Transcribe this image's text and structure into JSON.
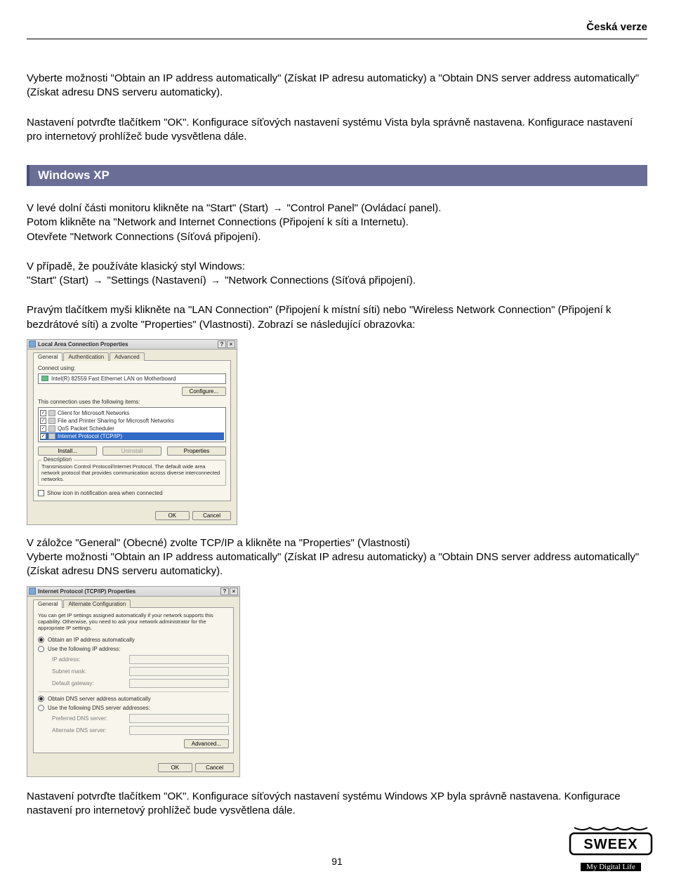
{
  "header": {
    "label": "Česká verze"
  },
  "intro": {
    "p1": "Vyberte možnosti \"Obtain an IP address automatically\" (Získat IP adresu automaticky) a \"Obtain DNS server address automatically\" (Získat adresu DNS serveru automaticky).",
    "p2": "Nastavení potvrďte tlačítkem \"OK\". Konfigurace síťových nastavení systému Vista byla správně nastavena. Konfigurace nastavení pro internetový prohlížeč bude vysvětlena dále."
  },
  "section": {
    "title": "Windows XP"
  },
  "xp": {
    "p1a": "V levé dolní části monitoru klikněte na \"Start\" (Start)",
    "p1b": "\"Control Panel\" (Ovládací panel).",
    "p2": "Potom klikněte na \"Network and Internet Connections (Připojení k síti a Internetu).",
    "p3": "Otevřete \"Network Connections (Síťová připojení).",
    "p4": "V případě, že používáte klasický styl Windows:",
    "p5a": "\"Start\" (Start)",
    "p5b": "\"Settings (Nastavení)",
    "p5c": "\"Network Connections (Síťová připojení).",
    "p6": "Pravým tlačítkem myši klikněte na \"LAN Connection\" (Připojení k místní síti) nebo \"Wireless Network Connection\" (Připojení k bezdrátové síti) a zvolte \"Properties\" (Vlastnosti). Zobrazí se následující obrazovka:"
  },
  "dlg1": {
    "title": "Local Area Connection Properties",
    "tabs": [
      "General",
      "Authentication",
      "Advanced"
    ],
    "connect_label": "Connect using:",
    "adapter": "Intel(R) 82559 Fast Ethernet LAN on Motherboard",
    "configure": "Configure...",
    "uses_label": "This connection uses the following items:",
    "items": [
      "Client for Microsoft Networks",
      "File and Printer Sharing for Microsoft Networks",
      "QoS Packet Scheduler",
      "Internet Protocol (TCP/IP)"
    ],
    "install": "Install...",
    "uninstall": "Uninstall",
    "properties": "Properties",
    "desc_label": "Description",
    "desc_text": "Transmission Control Protocol/Internet Protocol. The default wide area network protocol that provides communication across diverse interconnected networks.",
    "show_icon": "Show icon in notification area when connected",
    "ok": "OK",
    "cancel": "Cancel"
  },
  "mid": {
    "p1": "V záložce \"General\" (Obecné) zvolte TCP/IP a klikněte na \"Properties\" (Vlastnosti)",
    "p2": "Vyberte možnosti \"Obtain an IP address automatically\" (Získat IP adresu automaticky) a \"Obtain DNS server address automatically\" (Získat adresu DNS serveru automaticky)."
  },
  "dlg2": {
    "title": "Internet Protocol (TCP/IP) Properties",
    "tabs": [
      "General",
      "Alternate Configuration"
    ],
    "blurb": "You can get IP settings assigned automatically if your network supports this capability. Otherwise, you need to ask your network administrator for the appropriate IP settings.",
    "r1": "Obtain an IP address automatically",
    "r2": "Use the following IP address:",
    "ip": "IP address:",
    "subnet": "Subnet mask:",
    "gateway": "Default gateway:",
    "r3": "Obtain DNS server address automatically",
    "r4": "Use the following DNS server addresses:",
    "pdns": "Preferred DNS server:",
    "adns": "Alternate DNS server:",
    "advanced": "Advanced...",
    "ok": "OK",
    "cancel": "Cancel"
  },
  "outro": {
    "p1": "Nastavení potvrďte tlačítkem \"OK\". Konfigurace síťových nastavení systému Windows XP byla správně nastavena. Konfigurace nastavení pro internetový prohlížeč bude vysvětlena dále."
  },
  "footer": {
    "page": "91",
    "brand": "SWEEX",
    "tagline": "My Digital Life"
  }
}
